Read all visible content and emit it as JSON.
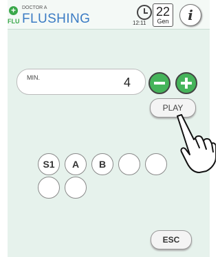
{
  "header": {
    "brand_plus": "+",
    "brand": "FLU",
    "subtitle": "DOCTOR A",
    "title": "FLUSHING",
    "time": "12:11",
    "gen_number": "22",
    "gen_label": "Gen",
    "info_label": "i",
    "clock_icon": "clock-icon"
  },
  "minutes": {
    "label": "MIN.",
    "value": "4"
  },
  "controls": {
    "play_label": "PLAY",
    "esc_label": "ESC",
    "minus_icon": "minus-icon",
    "plus_icon": "plus-icon",
    "hand_icon": "hand-pointer-icon"
  },
  "slots": [
    "S1",
    "A",
    "B",
    "",
    "",
    "",
    ""
  ],
  "colors": {
    "accent_green": "#45b45a",
    "title_blue": "#3a7bc4",
    "background": "#e6f2ec"
  }
}
